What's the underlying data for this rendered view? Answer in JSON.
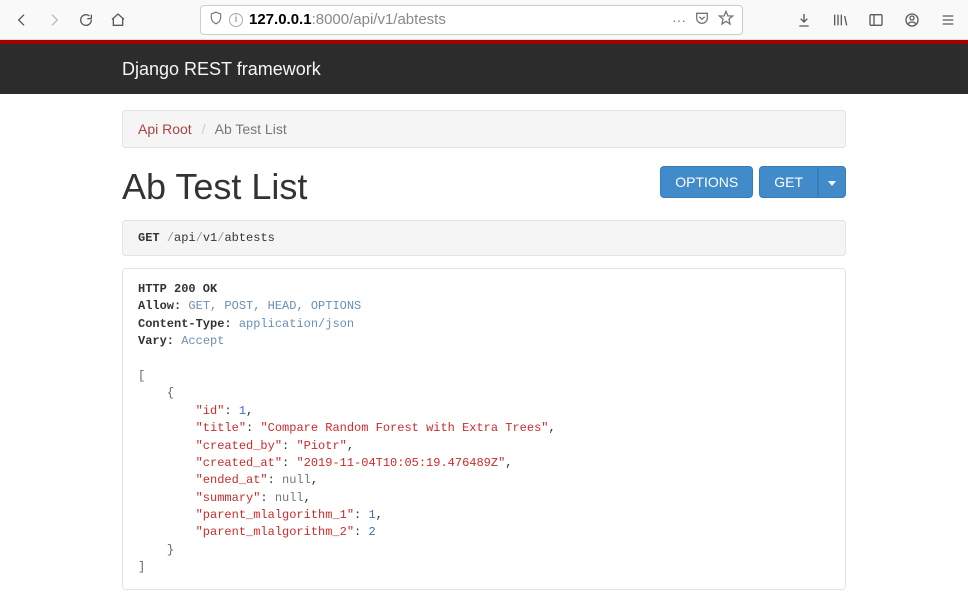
{
  "browser": {
    "url_host": "127.0.0.1",
    "url_rest": ":8000/api/v1/abtests",
    "ellipsis": "···"
  },
  "navbar": {
    "brand": "Django REST framework"
  },
  "breadcrumb": {
    "root": "Api Root",
    "sep": "/",
    "current": "Ab Test List"
  },
  "page": {
    "title": "Ab Test List"
  },
  "buttons": {
    "options": "OPTIONS",
    "get": "GET"
  },
  "request": {
    "method": "GET",
    "p1": "api",
    "p2": "v1",
    "p3": "abtests"
  },
  "response": {
    "status": "HTTP 200 OK",
    "h_allow_k": "Allow:",
    "h_allow_v": "GET, POST, HEAD, OPTIONS",
    "h_ct_k": "Content-Type:",
    "h_ct_v": "application/json",
    "h_vary_k": "Vary:",
    "h_vary_v": "Accept",
    "obj": {
      "id_k": "\"id\"",
      "id_v": "1",
      "title_k": "\"title\"",
      "title_v": "\"Compare Random Forest with Extra Trees\"",
      "cby_k": "\"created_by\"",
      "cby_v": "\"Piotr\"",
      "cat_k": "\"created_at\"",
      "cat_v": "\"2019-11-04T10:05:19.476489Z\"",
      "eat_k": "\"ended_at\"",
      "eat_v": "null",
      "sum_k": "\"summary\"",
      "sum_v": "null",
      "pm1_k": "\"parent_mlalgorithm_1\"",
      "pm1_v": "1",
      "pm2_k": "\"parent_mlalgorithm_2\"",
      "pm2_v": "2"
    }
  }
}
